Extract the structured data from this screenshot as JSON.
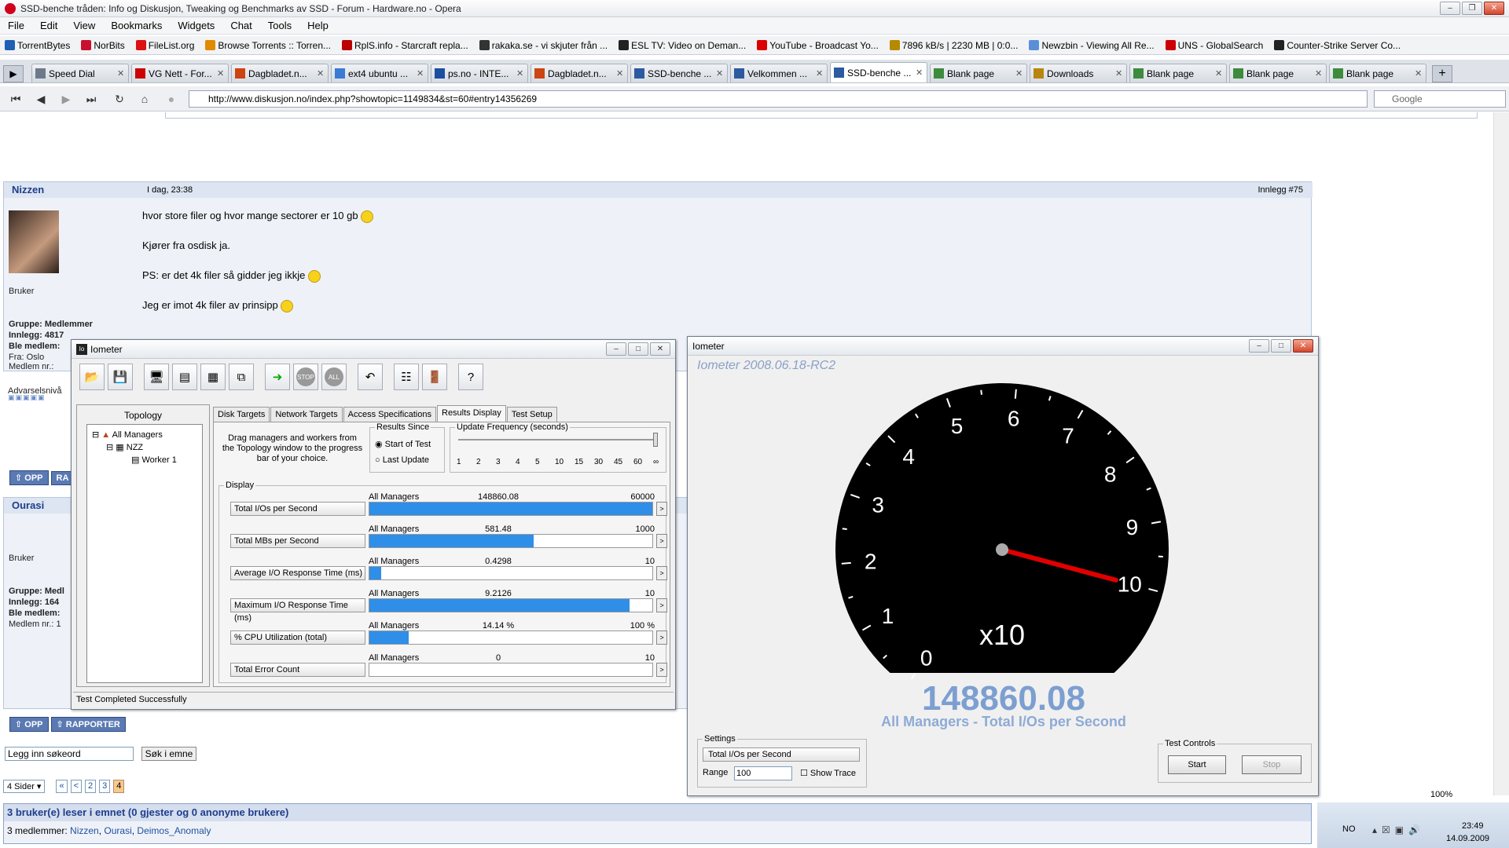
{
  "window": {
    "title": "SSD-benche tråden: Info og Diskusjon, Tweaking og Benchmarks av SSD - Forum - Hardware.no - Opera"
  },
  "menu": [
    "File",
    "Edit",
    "View",
    "Bookmarks",
    "Widgets",
    "Chat",
    "Tools",
    "Help"
  ],
  "bookmarks": [
    {
      "label": "TorrentBytes",
      "color": "#1f5fb4"
    },
    {
      "label": "NorBits",
      "color": "#c8102e"
    },
    {
      "label": "FileList.org",
      "color": "#d11"
    },
    {
      "label": "Browse Torrents :: Torren...",
      "color": "#e08a00"
    },
    {
      "label": "RplS.info - Starcraft repla...",
      "color": "#b00"
    },
    {
      "label": "rakaka.se - vi skjuter från ...",
      "color": "#333"
    },
    {
      "label": "ESL TV: Video on Deman...",
      "color": "#222"
    },
    {
      "label": "YouTube - Broadcast Yo...",
      "color": "#d00"
    },
    {
      "label": "7896 kB/s | 2230 MB | 0:0...",
      "color": "#b58900"
    },
    {
      "label": "Newzbin - Viewing All Re...",
      "color": "#5a8fd8"
    },
    {
      "label": "UNS - GlobalSearch",
      "color": "#c00"
    },
    {
      "label": "Counter-Strike Server Co...",
      "color": "#222"
    }
  ],
  "tabs": [
    {
      "label": "Speed Dial",
      "color": "#6d7a8a",
      "active": false
    },
    {
      "label": "VG Nett - For...",
      "color": "#c00",
      "active": false
    },
    {
      "label": "Dagbladet.n...",
      "color": "#c41",
      "active": false
    },
    {
      "label": "ext4 ubuntu ...",
      "color": "#3a7bd5",
      "active": false
    },
    {
      "label": "ps.no - INTE...",
      "color": "#1b4fa0",
      "active": false
    },
    {
      "label": "Dagbladet.n...",
      "color": "#c41",
      "active": false
    },
    {
      "label": "SSD-benche ...",
      "color": "#2c5aa0",
      "active": false
    },
    {
      "label": "Velkommen ...",
      "color": "#2c5aa0",
      "active": false
    },
    {
      "label": "SSD-benche ...",
      "color": "#2c5aa0",
      "active": true
    },
    {
      "label": "Blank page",
      "color": "#3d8b3d",
      "active": false
    },
    {
      "label": "Downloads",
      "color": "#b8860b",
      "active": false
    },
    {
      "label": "Blank page",
      "color": "#3d8b3d",
      "active": false
    },
    {
      "label": "Blank page",
      "color": "#3d8b3d",
      "active": false
    },
    {
      "label": "Blank page",
      "color": "#3d8b3d",
      "active": false
    }
  ],
  "address": {
    "url": "http://www.diskusjon.no/index.php?showtopic=1149834&st=60#entry14356269",
    "search_placeholder": "Google"
  },
  "post1": {
    "user": "Nizzen",
    "time": "I dag, 23:38",
    "post_no": "Innlegg #75",
    "rank": "Bruker",
    "group": "Gruppe: Medlemmer",
    "count": "Innlegg: 4817",
    "member": "Ble medlem:",
    "from": "Fra: Oslo",
    "nr": "Medlem nr.:",
    "warn": "Advarselsnivå",
    "lines": [
      "hvor store filer og hvor mange sectorer er 10 gb",
      "Kjører fra osdisk ja.",
      "PS: er det 4k filer så gidder jeg ikkje",
      "Jeg er imot 4k filer av prinsipp"
    ],
    "btn_up": "OPP",
    "btn_report": "RA"
  },
  "post2": {
    "user": "Ourasi",
    "rank": "Bruker",
    "group": "Gruppe: Medl",
    "count": "Innlegg: 164",
    "member": "Ble medlem:",
    "nr": "Medlem nr.: 1",
    "btn_up": "OPP",
    "btn_report": "RAPPORTER"
  },
  "forum": {
    "search_placeholder": "Legg inn søkeord",
    "search_btn": "Søk i emne",
    "pages_label": "4 Sider",
    "pages": [
      "«",
      "<",
      "2",
      "3",
      "4"
    ],
    "readers": "3 bruker(e) leser i emnet (0 gjester og 0 anonyme brukere)",
    "members_prefix": "3 medlemmer:",
    "members": [
      "Nizzen",
      "Ourasi",
      "Deimos_Anomaly"
    ]
  },
  "iometer": {
    "title": "Iometer",
    "topology_label": "Topology",
    "tree": [
      "All Managers",
      "NZZ",
      "Worker 1"
    ],
    "tabs": [
      "Disk Targets",
      "Network Targets",
      "Access Specifications",
      "Results Display",
      "Test Setup"
    ],
    "drag_text": "Drag managers and workers from the Topology window to the progress bar of your choice.",
    "results_since": {
      "label": "Results Since",
      "opt1": "Start of Test",
      "opt2": "Last Update"
    },
    "update_freq": {
      "label": "Update Frequency (seconds)",
      "ticks": [
        "1",
        "2",
        "3",
        "4",
        "5",
        "10",
        "15",
        "30",
        "45",
        "60",
        "∞"
      ]
    },
    "display_label": "Display",
    "metrics": [
      {
        "label": "Total I/Os per Second",
        "tag": "All Managers",
        "value": "148860.08",
        "max": "60000",
        "fill": 1.0
      },
      {
        "label": "Total MBs per Second",
        "tag": "All Managers",
        "value": "581.48",
        "max": "1000",
        "fill": 0.58
      },
      {
        "label": "Average I/O Response Time (ms)",
        "tag": "All Managers",
        "value": "0.4298",
        "max": "10",
        "fill": 0.043
      },
      {
        "label": "Maximum I/O Response Time (ms)",
        "tag": "All Managers",
        "value": "9.2126",
        "max": "10",
        "fill": 0.92
      },
      {
        "label": "% CPU Utilization (total)",
        "tag": "All Managers",
        "value": "14.14 %",
        "max": "100 %",
        "fill": 0.14
      },
      {
        "label": "Total Error Count",
        "tag": "All Managers",
        "value": "0",
        "max": "10",
        "fill": 0
      }
    ],
    "status": "Test Completed Successfully"
  },
  "gauge": {
    "title": "Iometer",
    "version": "Iometer 2008.06.18-RC2",
    "dial_labels": [
      "0",
      "1",
      "2",
      "3",
      "4",
      "5",
      "6",
      "7",
      "8",
      "9",
      "10"
    ],
    "multiplier": "x10",
    "value": "148860.08",
    "subtitle": "All Managers - Total I/Os per Second",
    "needle_value": 10,
    "settings": {
      "label": "Settings",
      "metric": "Total I/Os per Second",
      "range_label": "Range",
      "range_value": "100",
      "trace_label": "Show Trace"
    },
    "controls": {
      "label": "Test Controls",
      "start": "Start",
      "stop": "Stop"
    }
  },
  "system": {
    "lang": "NO",
    "time": "23:49",
    "date": "14.09.2009",
    "zoom": "100%"
  }
}
